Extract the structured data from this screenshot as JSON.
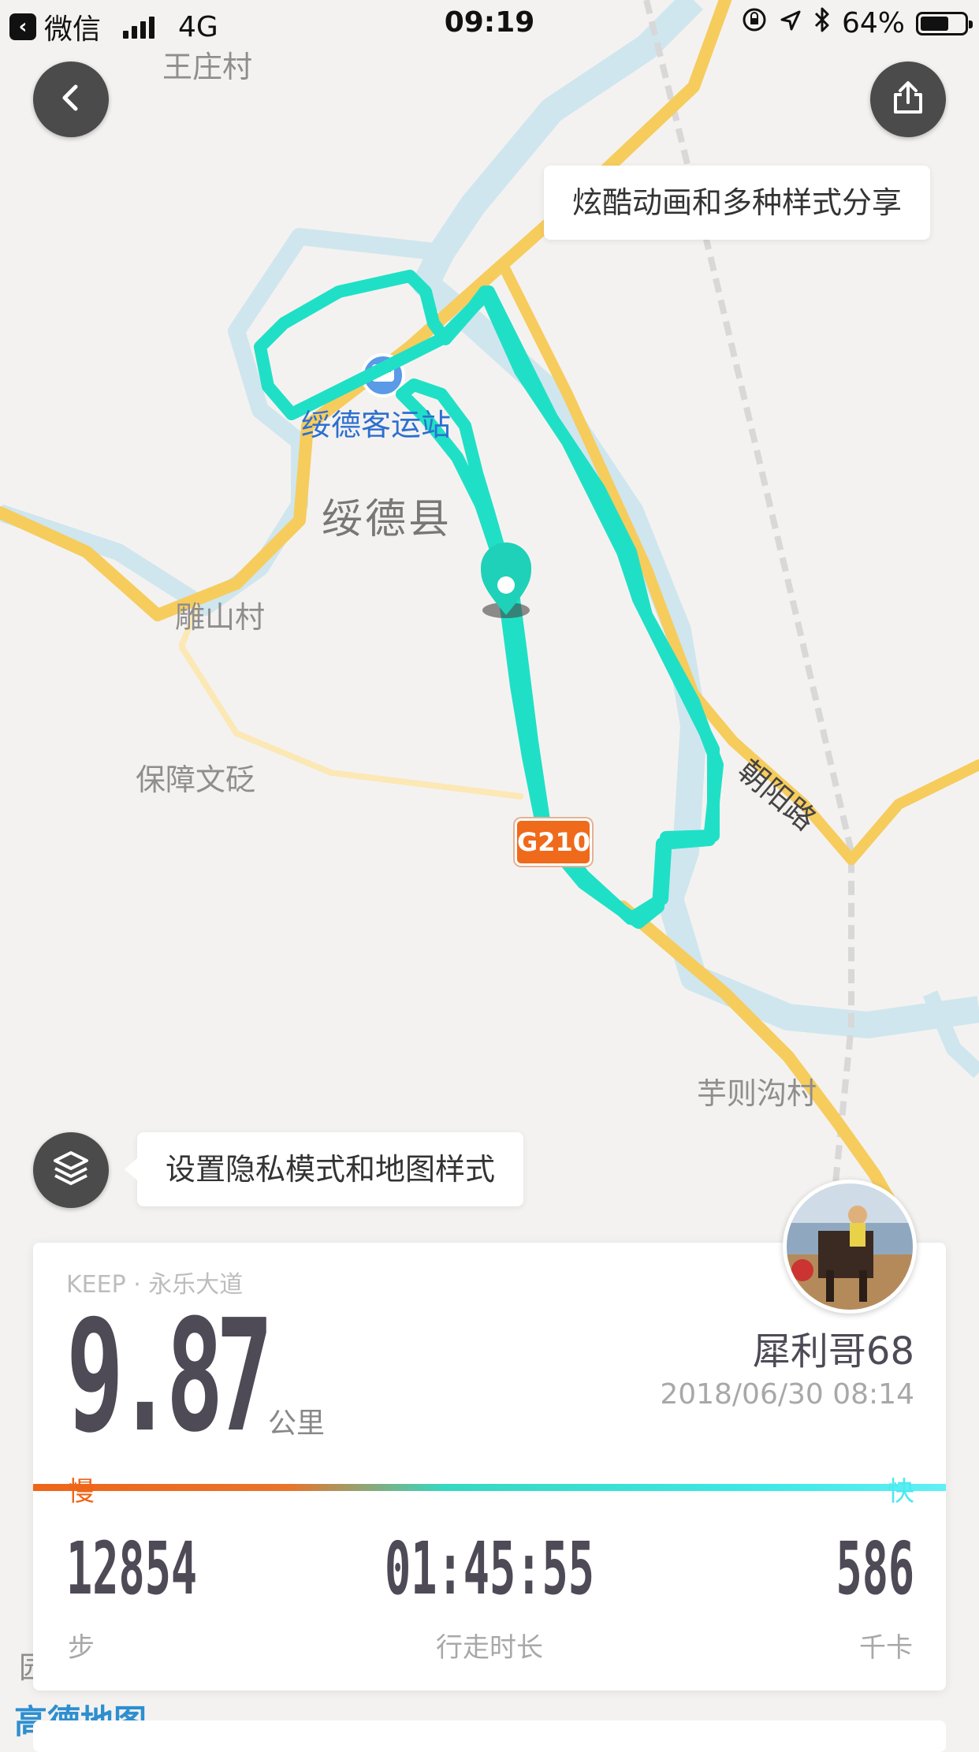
{
  "status_bar": {
    "back_app": "微信",
    "network": "4G",
    "time": "09:19",
    "battery": "64%",
    "battery_level": 0.64
  },
  "map": {
    "labels": {
      "wangzhuang": "王庄村",
      "station": "绥德客运站",
      "county": "绥德县",
      "diaoshan": "雕山村",
      "baozhang": "保障文砭",
      "road_top": "路",
      "chaoyang": "朝阳路",
      "yuze": "芋则沟村",
      "highway_badge": "G210",
      "left_edge": "园"
    },
    "amap_logo": "高德地图"
  },
  "buttons": {
    "share_tip": "炫酷动画和多种样式分享",
    "layer_tip": "设置隐私模式和地图样式"
  },
  "summary": {
    "source": "KEEP · 永乐大道",
    "distance": "9.87",
    "distance_unit": "公里",
    "username": "犀利哥68",
    "datetime": "2018/06/30 08:14",
    "pace_slow": "慢",
    "pace_fast": "快",
    "steps": "12854",
    "steps_label": "步",
    "duration": "01:45:55",
    "duration_label": "行走时长",
    "calories": "586",
    "calories_label": "千卡"
  },
  "colors": {
    "route": "#1fe0c6",
    "pace_slow": "#ef6518",
    "pace_fast": "#4ee8ef",
    "road": "#f6cc5d",
    "river": "#cfe6ee"
  }
}
